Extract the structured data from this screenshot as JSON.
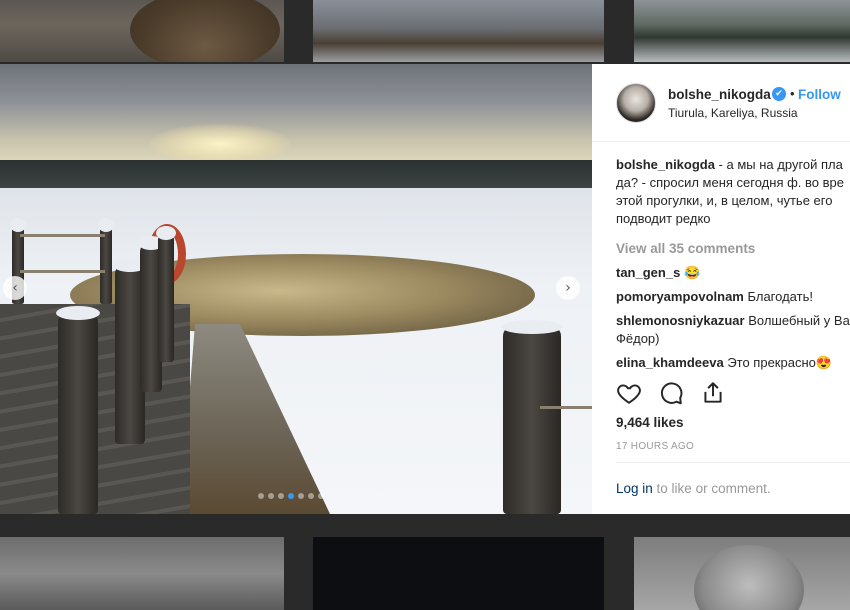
{
  "post": {
    "username": "bolshe_nikogda",
    "follow_label": "Follow",
    "separator": "•",
    "location": "Tiurula, Kareliya, Russia",
    "caption_user": "bolshe_nikogda",
    "caption_text": " - а мы на другой пла да? - спросил меня сегодня ф. во вре этой прогулки, и, в целом, чутье его подводит редко",
    "view_all_label": "View all 35 comments",
    "comments": [
      {
        "user": "tan_gen_s",
        "text": "😂"
      },
      {
        "user": "pomoryampovolnam",
        "text": "Благодать!"
      },
      {
        "user": "shlemonosniykazuar",
        "text": "Волшебный у Ва Фёдор)"
      },
      {
        "user": "elina_khamdeeva",
        "text": "Это прекрасно😍"
      }
    ],
    "likes": "9,464 likes",
    "timestamp": "17 HOURS AGO",
    "login_link": "Log in",
    "login_rest": " to like or comment.",
    "carousel_total": 7,
    "carousel_active": 4,
    "verified_mark": "✔",
    "nav_prev": "‹",
    "nav_next": "›"
  },
  "colors": {
    "accent": "#3897f0",
    "link_dark": "#003569",
    "muted": "#999999"
  },
  "icons": [
    "heart-icon",
    "comment-icon",
    "share-icon",
    "verified-badge-icon",
    "chevron-left-icon",
    "chevron-right-icon"
  ]
}
